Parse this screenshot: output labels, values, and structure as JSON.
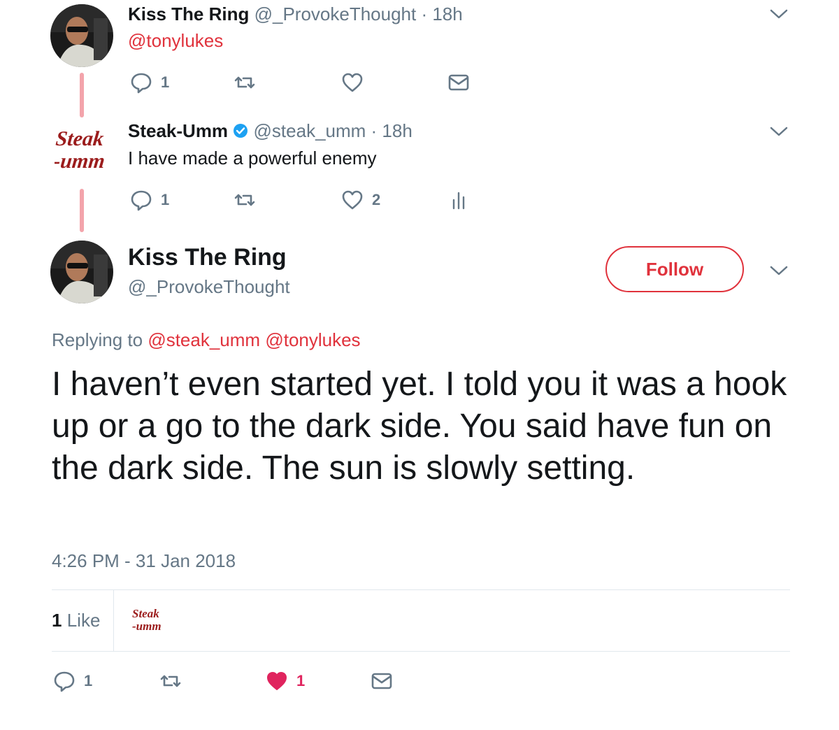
{
  "parent_tweet_1": {
    "name": "Kiss The Ring",
    "handle": "@_ProvokeThought",
    "sep": " · ",
    "time": "18h",
    "body_mention": "@tonylukes",
    "reply_count": "1",
    "avatar_icon": "profile-photo"
  },
  "parent_tweet_2": {
    "name": "Steak-Umm",
    "verified_icon": "verified-badge-icon",
    "handle": "@steak_umm",
    "sep": " · ",
    "time": "18h",
    "body": "I have made a powerful enemy",
    "reply_count": "1",
    "like_count": "2",
    "logo_line1": "Steak",
    "logo_line2": "-umm"
  },
  "main_tweet": {
    "name": "Kiss The Ring",
    "handle": "@_ProvokeThought",
    "follow_label": "Follow",
    "replying_prefix": "Replying to ",
    "replying_to_1": "@steak_umm",
    "replying_to_2": "@tonylukes",
    "text": "I haven’t even started yet. I told you it was a hook up or a go to the dark side. You said have fun on the dark side. The sun is slowly setting.",
    "timestamp": "4:26 PM - 31 Jan 2018",
    "likes_count": "1",
    "likes_label": "Like",
    "liker_logo_line1": "Steak",
    "liker_logo_line2": "-umm",
    "reply_count": "1",
    "like_count": "1"
  },
  "colors": {
    "accent": "#e0323c",
    "thread_line": "#f3a4ab",
    "muted": "#657786",
    "verified": "#1da1f2",
    "liked_heart": "#e0245e"
  }
}
